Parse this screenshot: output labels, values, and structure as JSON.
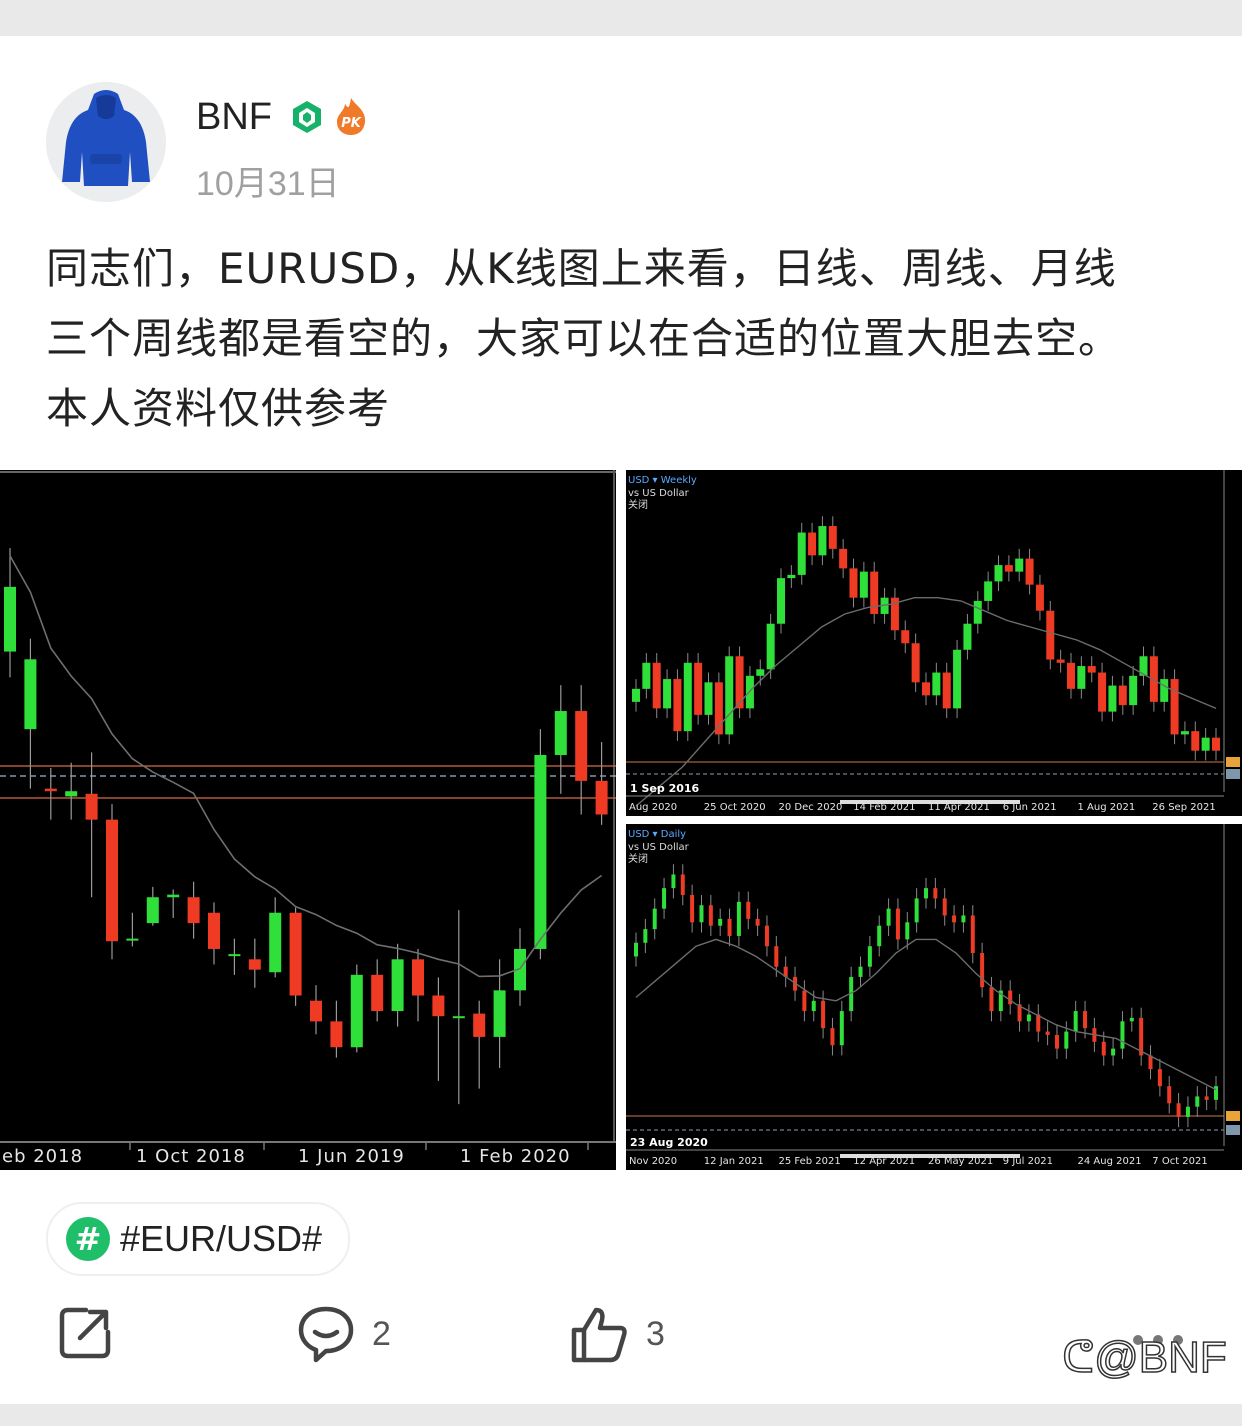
{
  "post": {
    "username": "BNF",
    "date": "10月31日",
    "text_lines": [
      "同志们，EURUSD，从K线图上来看，日线、周线、月线",
      "三个周线都是看空的，大家可以在合适的位置大胆去空。",
      "本人资料仅供参考"
    ],
    "topic": "#EUR/USD#",
    "comments": "2",
    "likes": "3",
    "watermark": "@BNF"
  },
  "chart_data": [
    {
      "type": "candlestick",
      "x_ticks": [
        "eb 2018",
        "1 Oct 2018",
        "1 Jun 2019",
        "1 Feb 2020"
      ],
      "candles": [
        {
          "o": 1.215,
          "c": 1.24,
          "h": 1.255,
          "l": 1.205
        },
        {
          "o": 1.185,
          "c": 1.212,
          "h": 1.22,
          "l": 1.162
        },
        {
          "o": 1.162,
          "c": 1.161,
          "h": 1.17,
          "l": 1.15
        },
        {
          "o": 1.159,
          "c": 1.161,
          "h": 1.172,
          "l": 1.15
        },
        {
          "o": 1.16,
          "c": 1.15,
          "h": 1.176,
          "l": 1.12
        },
        {
          "o": 1.15,
          "c": 1.103,
          "h": 1.156,
          "l": 1.096
        },
        {
          "o": 1.104,
          "c": 1.104,
          "h": 1.114,
          "l": 1.101
        },
        {
          "o": 1.11,
          "c": 1.12,
          "h": 1.124,
          "l": 1.109
        },
        {
          "o": 1.12,
          "c": 1.121,
          "h": 1.123,
          "l": 1.112
        },
        {
          "o": 1.12,
          "c": 1.11,
          "h": 1.126,
          "l": 1.104
        },
        {
          "o": 1.114,
          "c": 1.1,
          "h": 1.118,
          "l": 1.094
        },
        {
          "o": 1.098,
          "c": 1.098,
          "h": 1.104,
          "l": 1.09
        },
        {
          "o": 1.096,
          "c": 1.092,
          "h": 1.104,
          "l": 1.085
        },
        {
          "o": 1.091,
          "c": 1.114,
          "h": 1.12,
          "l": 1.089
        },
        {
          "o": 1.114,
          "c": 1.082,
          "h": 1.116,
          "l": 1.078
        },
        {
          "o": 1.08,
          "c": 1.072,
          "h": 1.086,
          "l": 1.067
        },
        {
          "o": 1.072,
          "c": 1.062,
          "h": 1.08,
          "l": 1.058
        },
        {
          "o": 1.062,
          "c": 1.09,
          "h": 1.094,
          "l": 1.06
        },
        {
          "o": 1.09,
          "c": 1.076,
          "h": 1.096,
          "l": 1.072
        },
        {
          "o": 1.076,
          "c": 1.096,
          "h": 1.102,
          "l": 1.07
        },
        {
          "o": 1.096,
          "c": 1.082,
          "h": 1.1,
          "l": 1.072
        },
        {
          "o": 1.082,
          "c": 1.074,
          "h": 1.089,
          "l": 1.049
        },
        {
          "o": 1.074,
          "c": 1.074,
          "h": 1.115,
          "l": 1.04
        },
        {
          "o": 1.075,
          "c": 1.066,
          "h": 1.08,
          "l": 1.046
        },
        {
          "o": 1.066,
          "c": 1.084,
          "h": 1.096,
          "l": 1.054
        },
        {
          "o": 1.084,
          "c": 1.1,
          "h": 1.108,
          "l": 1.078
        },
        {
          "o": 1.1,
          "c": 1.175,
          "h": 1.185,
          "l": 1.096
        },
        {
          "o": 1.175,
          "c": 1.192,
          "h": 1.202,
          "l": 1.16
        },
        {
          "o": 1.192,
          "c": 1.165,
          "h": 1.202,
          "l": 1.152
        },
        {
          "o": 1.165,
          "c": 1.152,
          "h": 1.18,
          "l": 1.148
        }
      ]
    },
    {
      "type": "candlestick",
      "title": "USD ▾ Weekly",
      "subtitle": "vs US Dollar",
      "subtitle2": "关闭",
      "marker": "1 Sep 2016",
      "x_ticks": [
        "Aug 2020",
        "25 Oct 2020",
        "20 Dec 2020",
        "14 Feb 2021",
        "11 Apr 2021",
        "6 Jun 2021",
        "1 Aug 2021",
        "26 Sep 2021"
      ],
      "closes": [
        1.178,
        1.186,
        1.172,
        1.181,
        1.165,
        1.186,
        1.17,
        1.18,
        1.164,
        1.188,
        1.172,
        1.182,
        1.184,
        1.198,
        1.212,
        1.213,
        1.226,
        1.219,
        1.228,
        1.221,
        1.215,
        1.206,
        1.214,
        1.201,
        1.206,
        1.196,
        1.192,
        1.18,
        1.176,
        1.183,
        1.172,
        1.19,
        1.198,
        1.205,
        1.211,
        1.216,
        1.214,
        1.218,
        1.21,
        1.202,
        1.187,
        1.186,
        1.178,
        1.185,
        1.183,
        1.171,
        1.179,
        1.173,
        1.182,
        1.188,
        1.174,
        1.181,
        1.164,
        1.165,
        1.159,
        1.163,
        1.159
      ],
      "ma_closes": [
        1.142,
        1.148,
        1.154,
        1.162,
        1.17,
        1.178,
        1.185,
        1.191,
        1.197,
        1.201,
        1.203,
        1.204,
        1.206,
        1.206,
        1.205,
        1.202,
        1.199,
        1.197,
        1.195,
        1.193,
        1.19,
        1.186,
        1.182,
        1.178,
        1.175,
        1.172
      ]
    },
    {
      "type": "candlestick",
      "title": "USD ▾ Daily",
      "subtitle": "vs US Dollar",
      "subtitle2": "关闭",
      "marker": "23 Aug 2020",
      "x_ticks": [
        "Nov 2020",
        "12 Jan 2021",
        "25 Feb 2021",
        "12 Apr 2021",
        "26 May 2021",
        "9 Jul 2021",
        "24 Aug 2021",
        "7 Oct 2021"
      ],
      "closes": [
        1.206,
        1.21,
        1.216,
        1.222,
        1.226,
        1.22,
        1.212,
        1.217,
        1.211,
        1.213,
        1.208,
        1.218,
        1.213,
        1.211,
        1.205,
        1.199,
        1.196,
        1.192,
        1.186,
        1.189,
        1.181,
        1.176,
        1.186,
        1.196,
        1.199,
        1.205,
        1.211,
        1.216,
        1.207,
        1.212,
        1.219,
        1.222,
        1.219,
        1.214,
        1.212,
        1.214,
        1.203,
        1.193,
        1.186,
        1.192,
        1.188,
        1.183,
        1.185,
        1.18,
        1.179,
        1.175,
        1.18,
        1.186,
        1.181,
        1.177,
        1.173,
        1.175,
        1.183,
        1.184,
        1.173,
        1.169,
        1.164,
        1.159,
        1.155,
        1.158,
        1.161,
        1.16,
        1.164
      ],
      "ma_closes": [
        1.19,
        1.195,
        1.2,
        1.205,
        1.207,
        1.205,
        1.202,
        1.198,
        1.194,
        1.19,
        1.189,
        1.192,
        1.197,
        1.203,
        1.207,
        1.207,
        1.203,
        1.197,
        1.192,
        1.188,
        1.185,
        1.182,
        1.18,
        1.179,
        1.178,
        1.175,
        1.172,
        1.169,
        1.166,
        1.163
      ]
    }
  ]
}
